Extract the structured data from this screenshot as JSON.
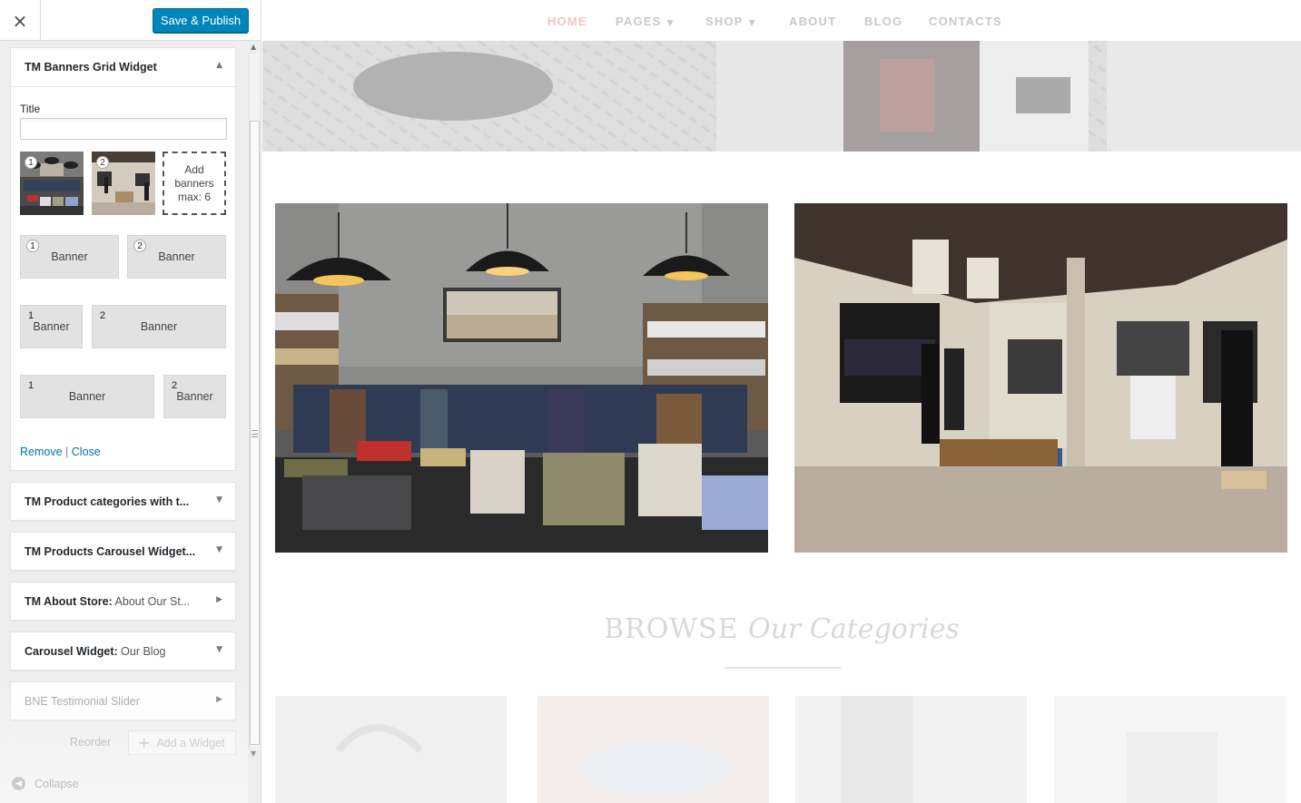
{
  "topbar": {
    "close_icon": "×",
    "save_label": "Save & Publish",
    "accent_color": "#0085ba"
  },
  "open_widget": {
    "title": "TM Banners Grid Widget",
    "title_field_label": "Title",
    "title_field_value": "",
    "thumb1_number": "1",
    "thumb2_number": "2",
    "add_banners_line1": "Add",
    "add_banners_line2": "banners",
    "add_banners_line3": "max: 6",
    "layouts": [
      {
        "n1": "1",
        "l1": "Banner",
        "n2": "2",
        "l2": "Banner"
      },
      {
        "n1": "1",
        "l1": "Banner",
        "n2": "2",
        "l2": "Banner"
      },
      {
        "n1": "1",
        "l1": "Banner",
        "n2": "2",
        "l2": "Banner"
      }
    ],
    "remove_label": "Remove",
    "separator": "|",
    "close_label": "Close"
  },
  "widgets": [
    {
      "title": "TM Product categories with t...",
      "sub": "",
      "arrow": "▼"
    },
    {
      "title": "TM Products Carousel Widget...",
      "sub": "",
      "arrow": "▼"
    },
    {
      "title": "TM About Store:",
      "sub": " About Our St...",
      "arrow": "▶"
    },
    {
      "title": "Carousel Widget:",
      "sub": " Our Blog",
      "arrow": "▼"
    },
    {
      "title": "BNE Testimonial Slider",
      "sub": "",
      "arrow": "▶"
    }
  ],
  "footer": {
    "reorder_label": "Reorder",
    "add_widget_label": "Add a Widget",
    "collapse_label": "Collapse"
  },
  "nav": {
    "items": [
      "HOME",
      "PAGES",
      "SHOP",
      "ABOUT",
      "BLOG",
      "CONTACTS"
    ],
    "active_color": "#f6c2c2"
  },
  "section": {
    "browse_bold": "BROWSE",
    "browse_italic": "Our Categories"
  }
}
